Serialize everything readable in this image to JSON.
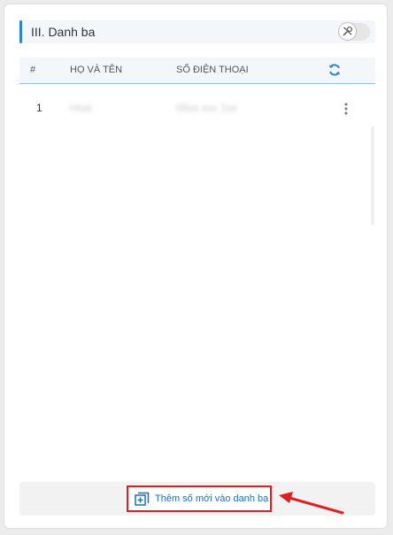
{
  "section": {
    "title": "III. Danh ba"
  },
  "table": {
    "headers": {
      "number": "#",
      "name": "HỌ VÀ TÊN",
      "phone": "SỐ ĐIỆN THOẠI"
    },
    "rows": [
      {
        "number": "1",
        "name": "Hoai",
        "phone": "09xx xxx 1xx"
      }
    ]
  },
  "footer": {
    "add_label": "Thêm số mới vào danh bạ"
  },
  "colors": {
    "accent": "#2a88c8",
    "link": "#1a73b8",
    "highlight": "#e02020"
  },
  "icons": {
    "toggle": "tools-icon",
    "refresh": "refresh-icon",
    "row_menu": "more-vertical-icon",
    "add": "add-copy-icon"
  }
}
